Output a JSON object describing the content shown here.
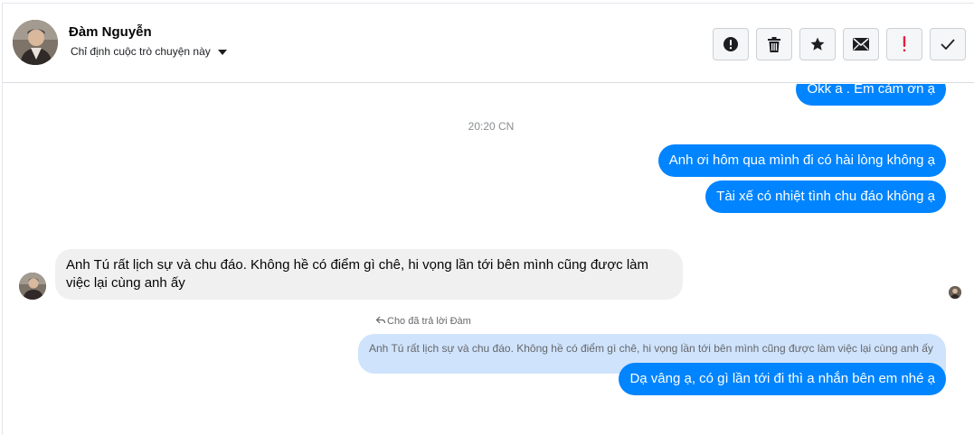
{
  "header": {
    "name": "Đàm Nguyễn",
    "subtitle": "Chỉ định cuộc trò chuyện này"
  },
  "toolbar": {
    "icons": [
      "exclamation-circle-icon",
      "trash-icon",
      "star-icon",
      "envelope-icon",
      "exclamation-icon",
      "checkmark-icon"
    ],
    "accent_red": "#e41e3f"
  },
  "colors": {
    "outgoing_bubble": "#0084ff",
    "incoming_bubble": "#f0f0f0",
    "quote_bubble": "#cfe3fc"
  },
  "messages": {
    "m0": "Okk a . Em cảm ơn ạ",
    "timestamp": "20:20 CN",
    "m1": "Anh ơi hôm qua mình đi có hài lòng không ạ",
    "m2": "Tài xế có nhiệt tình chu đáo không ạ",
    "m3": "Anh Tú rất lịch sự và chu đáo. Không hề có điểm gì chê, hi vọng lần tới bên mình cũng được làm việc lại cùng anh ấy",
    "reply_note": "Cho đã trả lời Đàm",
    "quote": "Anh Tú rất lịch sự và chu đáo. Không hề có điểm gì chê, hi vọng lần tới bên mình cũng được làm việc lại cùng anh ấy",
    "m4": "Dạ vâng ạ, có gì lần tới đi thì a nhắn bên em nhé ạ"
  }
}
